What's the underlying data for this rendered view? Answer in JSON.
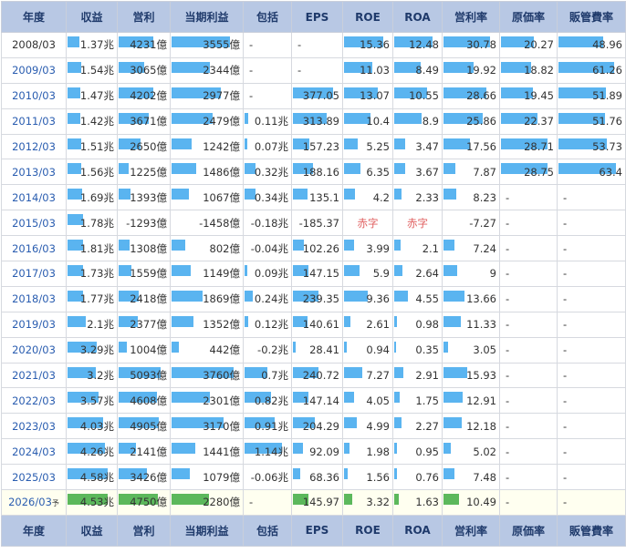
{
  "columns": [
    "年度",
    "収益",
    "営利",
    "当期利益",
    "包括",
    "EPS",
    "ROE",
    "ROA",
    "営利率",
    "原価率",
    "販管費率"
  ],
  "max": [
    4.58,
    5093,
    3760,
    1.14,
    377.05,
    15.36,
    12.48,
    30.78,
    28.75,
    63.4
  ],
  "rows": [
    {
      "year": "2008/03",
      "link": false,
      "cells": [
        "1.37兆",
        "4231億",
        "3555億",
        "-",
        "-",
        "15.36",
        "12.48",
        "30.78",
        "20.27",
        "48.96"
      ],
      "v": [
        1.37,
        4231,
        3555,
        null,
        null,
        15.36,
        12.48,
        30.78,
        20.27,
        48.96
      ]
    },
    {
      "year": "2009/03",
      "link": true,
      "cells": [
        "1.54兆",
        "3065億",
        "2344億",
        "-",
        "-",
        "11.03",
        "8.49",
        "19.92",
        "18.82",
        "61.26"
      ],
      "v": [
        1.54,
        3065,
        2344,
        null,
        null,
        11.03,
        8.49,
        19.92,
        18.82,
        61.26
      ]
    },
    {
      "year": "2010/03",
      "link": true,
      "cells": [
        "1.47兆",
        "4202億",
        "2977億",
        "-",
        "377.05",
        "13.07",
        "10.55",
        "28.66",
        "19.45",
        "51.89"
      ],
      "v": [
        1.47,
        4202,
        2977,
        null,
        377.05,
        13.07,
        10.55,
        28.66,
        19.45,
        51.89
      ]
    },
    {
      "year": "2011/03",
      "link": true,
      "cells": [
        "1.42兆",
        "3671億",
        "2479億",
        "0.11兆",
        "313.89",
        "10.4",
        "8.9",
        "25.86",
        "22.37",
        "51.76"
      ],
      "v": [
        1.42,
        3671,
        2479,
        0.11,
        313.89,
        10.4,
        8.9,
        25.86,
        22.37,
        51.76
      ]
    },
    {
      "year": "2012/03",
      "link": true,
      "cells": [
        "1.51兆",
        "2650億",
        "1242億",
        "0.07兆",
        "157.23",
        "5.25",
        "3.47",
        "17.56",
        "28.71",
        "53.73"
      ],
      "v": [
        1.51,
        2650,
        1242,
        0.07,
        157.23,
        5.25,
        3.47,
        17.56,
        28.71,
        53.73
      ]
    },
    {
      "year": "2013/03",
      "link": true,
      "cells": [
        "1.56兆",
        "1225億",
        "1486億",
        "0.32兆",
        "188.16",
        "6.35",
        "3.67",
        "7.87",
        "28.75",
        "63.4"
      ],
      "v": [
        1.56,
        1225,
        1486,
        0.32,
        188.16,
        6.35,
        3.67,
        7.87,
        28.75,
        63.4
      ]
    },
    {
      "year": "2014/03",
      "link": true,
      "cells": [
        "1.69兆",
        "1393億",
        "1067億",
        "0.34兆",
        "135.1",
        "4.2",
        "2.33",
        "8.23",
        "-",
        "-"
      ],
      "v": [
        1.69,
        1393,
        1067,
        0.34,
        135.1,
        4.2,
        2.33,
        8.23,
        null,
        null
      ]
    },
    {
      "year": "2015/03",
      "link": true,
      "cells": [
        "1.78兆",
        "-1293億",
        "-1458億",
        "-0.18兆",
        "-185.37",
        "赤字",
        "赤字",
        "-7.27",
        "-",
        "-"
      ],
      "v": [
        1.78,
        null,
        null,
        null,
        null,
        null,
        null,
        null,
        null,
        null
      ]
    },
    {
      "year": "2016/03",
      "link": true,
      "cells": [
        "1.81兆",
        "1308億",
        "802億",
        "-0.04兆",
        "102.26",
        "3.99",
        "2.1",
        "7.24",
        "-",
        "-"
      ],
      "v": [
        1.81,
        1308,
        802,
        null,
        102.26,
        3.99,
        2.1,
        7.24,
        null,
        null
      ]
    },
    {
      "year": "2017/03",
      "link": true,
      "cells": [
        "1.73兆",
        "1559億",
        "1149億",
        "0.09兆",
        "147.15",
        "5.9",
        "2.64",
        "9",
        "-",
        "-"
      ],
      "v": [
        1.73,
        1559,
        1149,
        0.09,
        147.15,
        5.9,
        2.64,
        9,
        null,
        null
      ]
    },
    {
      "year": "2018/03",
      "link": true,
      "cells": [
        "1.77兆",
        "2418億",
        "1869億",
        "0.24兆",
        "239.35",
        "9.36",
        "4.55",
        "13.66",
        "-",
        "-"
      ],
      "v": [
        1.77,
        2418,
        1869,
        0.24,
        239.35,
        9.36,
        4.55,
        13.66,
        null,
        null
      ]
    },
    {
      "year": "2019/03",
      "link": true,
      "cells": [
        "2.1兆",
        "2377億",
        "1352億",
        "0.12兆",
        "140.61",
        "2.61",
        "0.98",
        "11.33",
        "-",
        "-"
      ],
      "v": [
        2.1,
        2377,
        1352,
        0.12,
        140.61,
        2.61,
        0.98,
        11.33,
        null,
        null
      ]
    },
    {
      "year": "2020/03",
      "link": true,
      "cells": [
        "3.29兆",
        "1004億",
        "442億",
        "-0.2兆",
        "28.41",
        "0.94",
        "0.35",
        "3.05",
        "-",
        "-"
      ],
      "v": [
        3.29,
        1004,
        442,
        null,
        28.41,
        0.94,
        0.35,
        3.05,
        null,
        null
      ]
    },
    {
      "year": "2021/03",
      "link": true,
      "cells": [
        "3.2兆",
        "5093億",
        "3760億",
        "0.7兆",
        "240.72",
        "7.27",
        "2.91",
        "15.93",
        "-",
        "-"
      ],
      "v": [
        3.2,
        5093,
        3760,
        0.7,
        240.72,
        7.27,
        2.91,
        15.93,
        null,
        null
      ]
    },
    {
      "year": "2022/03",
      "link": true,
      "cells": [
        "3.57兆",
        "4608億",
        "2301億",
        "0.82兆",
        "147.14",
        "4.05",
        "1.75",
        "12.91",
        "-",
        "-"
      ],
      "v": [
        3.57,
        4608,
        2301,
        0.82,
        147.14,
        4.05,
        1.75,
        12.91,
        null,
        null
      ]
    },
    {
      "year": "2023/03",
      "link": true,
      "cells": [
        "4.03兆",
        "4905億",
        "3170億",
        "0.91兆",
        "204.29",
        "4.99",
        "2.27",
        "12.18",
        "-",
        "-"
      ],
      "v": [
        4.03,
        4905,
        3170,
        0.91,
        204.29,
        4.99,
        2.27,
        12.18,
        null,
        null
      ]
    },
    {
      "year": "2024/03",
      "link": true,
      "cells": [
        "4.26兆",
        "2141億",
        "1441億",
        "1.14兆",
        "92.09",
        "1.98",
        "0.95",
        "5.02",
        "-",
        "-"
      ],
      "v": [
        4.26,
        2141,
        1441,
        1.14,
        92.09,
        1.98,
        0.95,
        5.02,
        null,
        null
      ]
    },
    {
      "year": "2025/03",
      "link": true,
      "cells": [
        "4.58兆",
        "3426億",
        "1079億",
        "-0.06兆",
        "68.36",
        "1.56",
        "0.76",
        "7.48",
        "-",
        "-"
      ],
      "v": [
        4.58,
        3426,
        1079,
        null,
        68.36,
        1.56,
        0.76,
        7.48,
        null,
        null
      ]
    },
    {
      "year": "2026/03",
      "link": true,
      "forecast": true,
      "suffix": "予",
      "cells": [
        "4.53兆",
        "4750億",
        "2280億",
        "-",
        "145.97",
        "3.32",
        "1.63",
        "10.49",
        "-",
        "-"
      ],
      "v": [
        4.53,
        4750,
        2280,
        null,
        145.97,
        3.32,
        1.63,
        10.49,
        null,
        null
      ]
    }
  ]
}
